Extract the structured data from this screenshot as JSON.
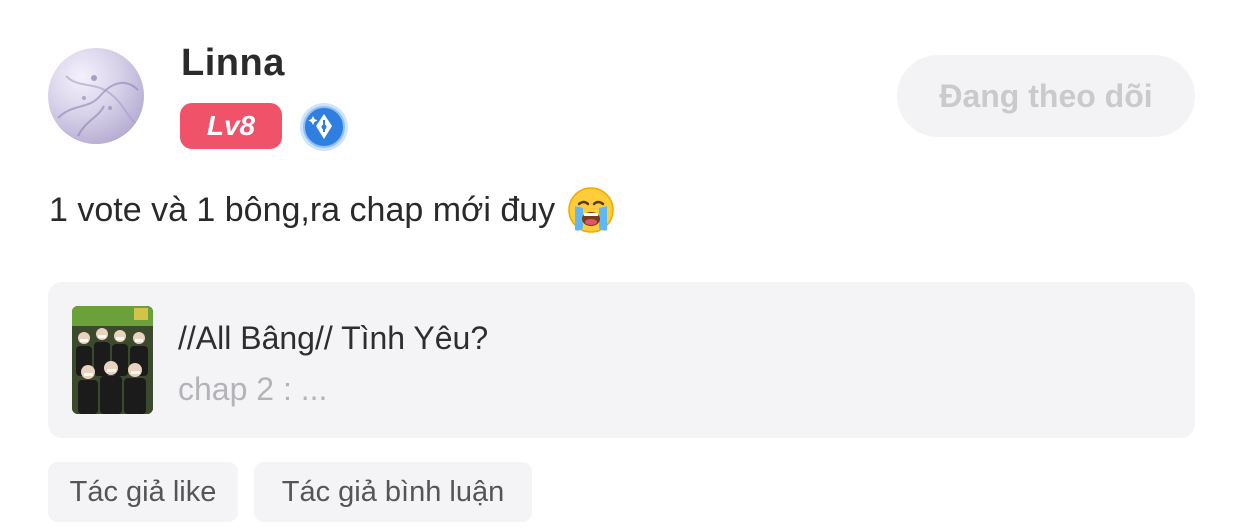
{
  "author": {
    "name": "Linna",
    "level": "Lv8",
    "avatar_icon": "avatar-image",
    "badge_icon": "pen-nib-badge-icon",
    "level_color": "#f0526a",
    "badge_color": "#2f7fe0"
  },
  "follow": {
    "label": "Đang theo dõi"
  },
  "post": {
    "text": "1 vote và 1 bông,ra chap mới đuy",
    "emoji": "loudly-crying-face"
  },
  "linked_story": {
    "title": "//All Bâng// Tình Yêu?",
    "chapter": "chap 2 : ..."
  },
  "tags": [
    {
      "label": "Tác giả like"
    },
    {
      "label": "Tác giả bình luận"
    }
  ]
}
